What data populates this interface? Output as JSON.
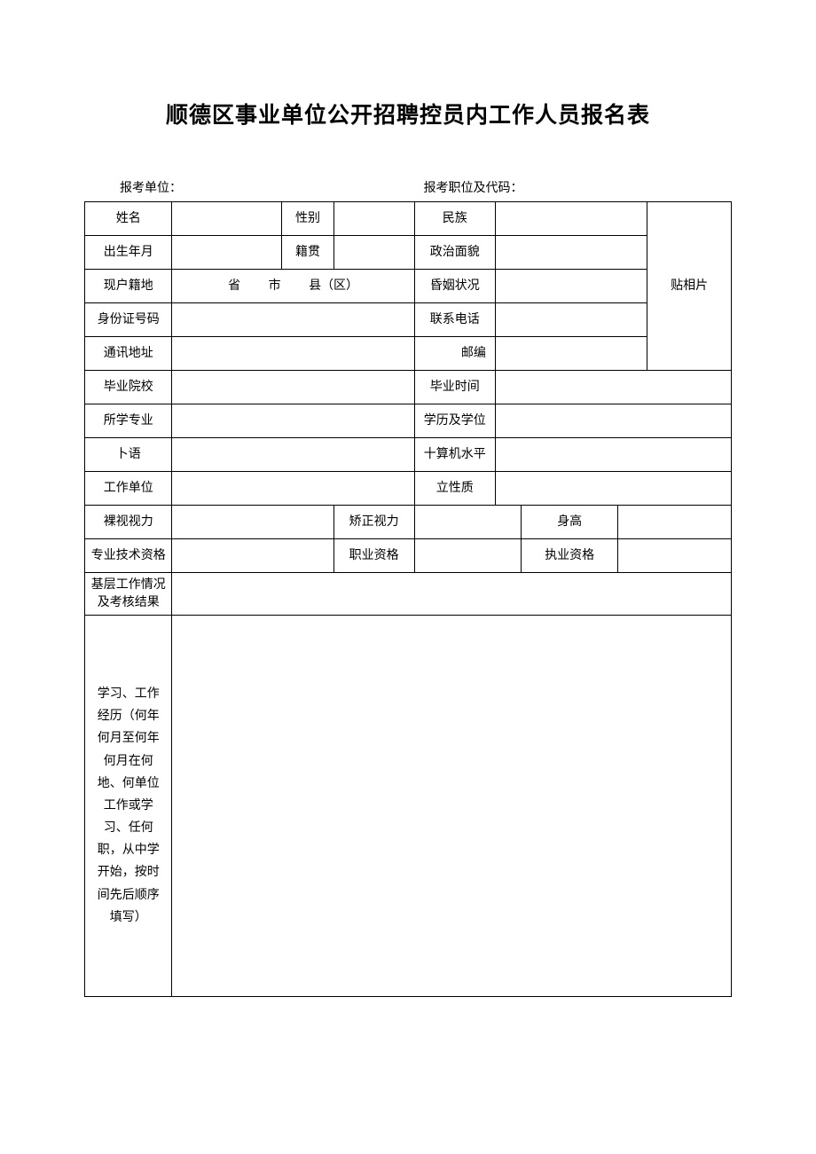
{
  "title": "顺德区事业单位公开招聘控员内工作人员报名表",
  "header": {
    "unit_label": "报考单位：",
    "position_label": "报考职位及代码："
  },
  "labels": {
    "name": "姓名",
    "gender": "性别",
    "ethnicity": "民族",
    "birth_date": "出生年月",
    "native_place": "籍贯",
    "political_status": "政治面貌",
    "current_residence": "现户籍地",
    "province": "省",
    "city": "市",
    "county": "县（区）",
    "marital_status": "昏姻状况",
    "photo": "贴相片",
    "id_number": "身份证号码",
    "phone": "联系电话",
    "mailing_address": "通讯地址",
    "postcode": "邮编",
    "school": "毕业院校",
    "graduation_time": "毕业时间",
    "major": "所学专业",
    "degree": "学历及学位",
    "foreign_language": "卜语",
    "computer_level": "十算机水平",
    "work_unit": "工作单位",
    "unit_nature": "立性质",
    "naked_vision": "裸视视力",
    "corrected_vision": "矫正视力",
    "height": "身高",
    "professional_qualification": "专业技术资格",
    "vocational_qualification": "职业资格",
    "practice_qualification": "执业资格",
    "grassroots_work": "基层工作情况及考核结果",
    "experience": "学习、工作经历（何年何月至何年何月在何地、何单位工作或学习、任何职，从中学开始，按时间先后顺序填写）"
  }
}
